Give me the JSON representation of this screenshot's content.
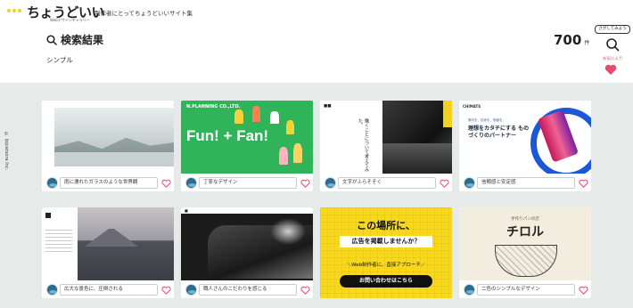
{
  "header": {
    "logo": "ちょうどいい",
    "logo_sub": "Webデザインギャラリー",
    "tagline": "制作者にとってちょうどいいサイト集",
    "search_title": "検索結果",
    "count": "700",
    "count_unit": "件",
    "keyword": "シンプル"
  },
  "side": {
    "search_bubble": "さがしてみよう",
    "favorite_label": "お気に入り"
  },
  "copyright": "© Ippiatsora Inc.",
  "cards": [
    {
      "tag": "雨に濡れたガラスのような世界観"
    },
    {
      "tag": "丁寧なデザイン",
      "thumb_brand": "N.PLANNING CO.,LTD.",
      "thumb_headline": "Fun! + Fan!"
    },
    {
      "tag": "文字がふらそそぐ",
      "thumb_vertical": "働くことについて考えてみた。"
    },
    {
      "tag": "信頼感と安定感",
      "thumb_logo": "CHIMATS",
      "thumb_small": "素材を、技術を、価値を。",
      "thumb_headline": "理想をカタチにする ものづくりのパートナー"
    },
    {
      "tag": "広大な景色に、圧倒される"
    },
    {
      "tag": "職人さんのこだわりを感じる"
    },
    {
      "ad_line1": "この場所に、",
      "ad_line2": "広告を掲載しませんか？",
      "ad_line3": "＼Web制作者に、直接アプローチ／",
      "ad_button": "お問い合わせはこちら"
    },
    {
      "tag": "二色のシンプルなデザイン",
      "thumb_small": "手作りパンの店",
      "thumb_headline": "チロル"
    }
  ],
  "colors": {
    "background": "#e6eae8",
    "heart": "#e54c6d",
    "logo_dots": "#f3d21f",
    "ad_yellow": "#f7d81f"
  },
  "icons": [
    "search-icon",
    "heart-icon"
  ]
}
